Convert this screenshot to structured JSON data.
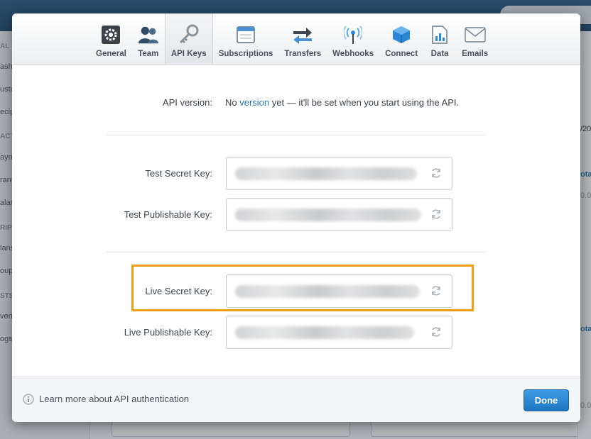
{
  "background": {
    "sidebar_items": [
      "AL",
      "ash",
      "usto",
      "ecip",
      "ACT",
      "aym",
      "rans",
      "alar",
      "RIPT",
      "lans",
      "oup",
      "STS",
      "vent",
      "ogs"
    ],
    "right_snippets": [
      "/20",
      "ota",
      "0.0",
      "ota",
      "0.0"
    ]
  },
  "tabs": [
    {
      "label": "General",
      "icon": "gear-icon",
      "active": false
    },
    {
      "label": "Team",
      "icon": "team-icon",
      "active": false
    },
    {
      "label": "API Keys",
      "icon": "key-icon",
      "active": true
    },
    {
      "label": "Subscriptions",
      "icon": "subscriptions-icon",
      "active": false
    },
    {
      "label": "Transfers",
      "icon": "transfers-icon",
      "active": false
    },
    {
      "label": "Webhooks",
      "icon": "webhooks-icon",
      "active": false
    },
    {
      "label": "Connect",
      "icon": "connect-icon",
      "active": false
    },
    {
      "label": "Data",
      "icon": "data-icon",
      "active": false
    },
    {
      "label": "Emails",
      "icon": "emails-icon",
      "active": false
    }
  ],
  "api_version": {
    "label": "API version:",
    "prefix": "No ",
    "link": "version",
    "suffix": " yet — it'll be set when you start using the API."
  },
  "keys": [
    {
      "label": "Test Secret Key:",
      "value": "sk_test_••••••••••••••••••••••••"
    },
    {
      "label": "Test Publishable Key:",
      "value": "pk_test_••••••••••••••••••••••••"
    },
    {
      "label": "Live Secret Key:",
      "value": "sk_live_••••••••••••••••••••••••"
    },
    {
      "label": "Live Publishable Key:",
      "value": "pk_live_••••••••••••••••••••••••"
    }
  ],
  "footer": {
    "link": "Learn more about API authentication",
    "done": "Done"
  },
  "colors": {
    "accent": "#2a7bb5",
    "highlight": "#f39c12",
    "done": "#2a86d6"
  }
}
